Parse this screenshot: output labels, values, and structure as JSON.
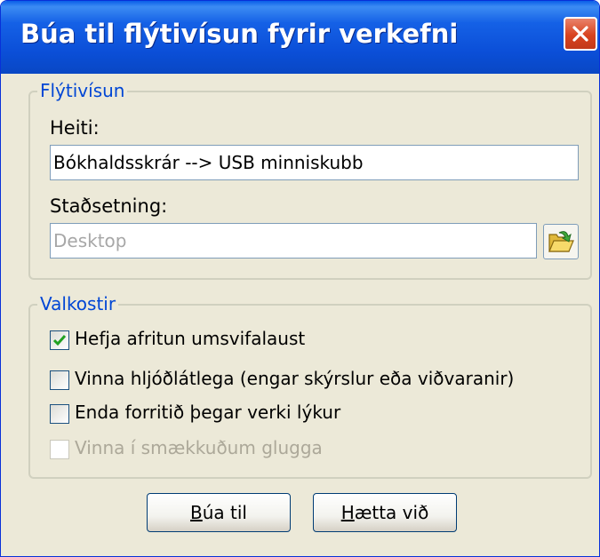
{
  "window": {
    "title": "Búa til flýtivísun fyrir verkefni"
  },
  "shortcut_group": {
    "legend": "Flýtivísun",
    "name_label": "Heiti:",
    "name_value": "Bókhaldsskrár --> USB minniskubb",
    "location_label": "Staðsetning:",
    "location_value": "Desktop"
  },
  "options_group": {
    "legend": "Valkostir",
    "options": [
      {
        "label": "Hefja afritun umsvifalaust",
        "checked": true,
        "enabled": true
      },
      {
        "label": "Vinna hljóðlátlega (engar skýrslur eða viðvaranir)",
        "checked": false,
        "enabled": true
      },
      {
        "label": "Enda forritið þegar verki lýkur",
        "checked": false,
        "enabled": true
      },
      {
        "label": "Vinna í smækkuðum glugga",
        "checked": false,
        "enabled": false
      }
    ]
  },
  "buttons": {
    "create_mnemonic": "B",
    "create_rest": "úa til",
    "cancel_mnemonic": "H",
    "cancel_rest": "ætta við"
  },
  "icons": {
    "close": "close-icon",
    "browse": "folder-browse-icon",
    "check": "checkmark-icon"
  },
  "colors": {
    "titlebar": "#0b4fd8",
    "close_button": "#d8431f",
    "group_legend": "#0046d5",
    "dialog_background": "#ece9d8",
    "checkmark": "#21a121"
  }
}
